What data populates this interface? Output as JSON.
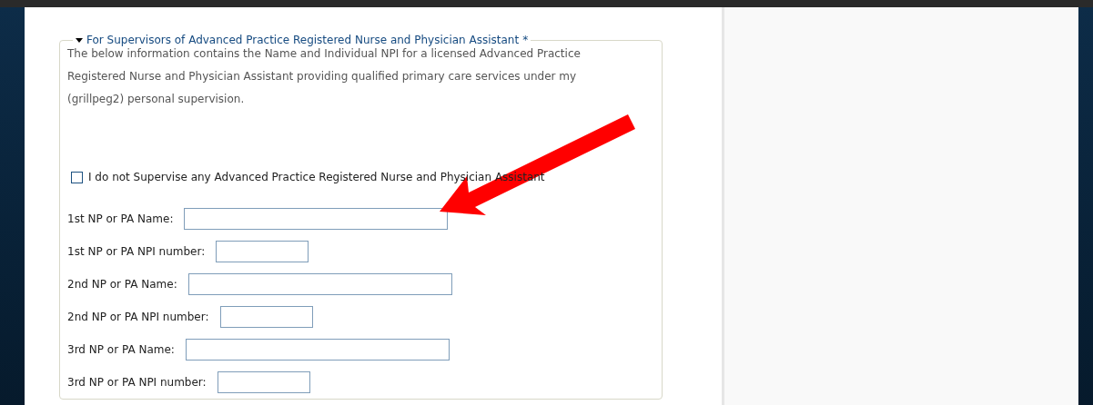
{
  "section": {
    "legend": "For Supervisors of Advanced Practice Registered Nurse and Physician Assistant",
    "required_mark": "*",
    "expanded": true,
    "description": "The below information contains the Name and Individual NPI for a licensed Advanced Practice Registered  Nurse and Physician Assistant providing qualified primary care services under my (grillpeg2) personal supervision.",
    "opt_out": {
      "label": "I do not Supervise any Advanced Practice Registered Nurse and Physician Assistant",
      "checked": false
    },
    "fields": [
      {
        "label": "1st NP or PA Name:",
        "kind": "name"
      },
      {
        "label": "1st NP or PA NPI number:",
        "kind": "npi"
      },
      {
        "label": "2nd NP or PA Name:",
        "kind": "name"
      },
      {
        "label": "2nd NP or PA NPI number:",
        "kind": "npi"
      },
      {
        "label": "3rd NP or PA Name:",
        "kind": "name"
      },
      {
        "label": "3rd NP or PA NPI number:",
        "kind": "npi"
      }
    ]
  }
}
